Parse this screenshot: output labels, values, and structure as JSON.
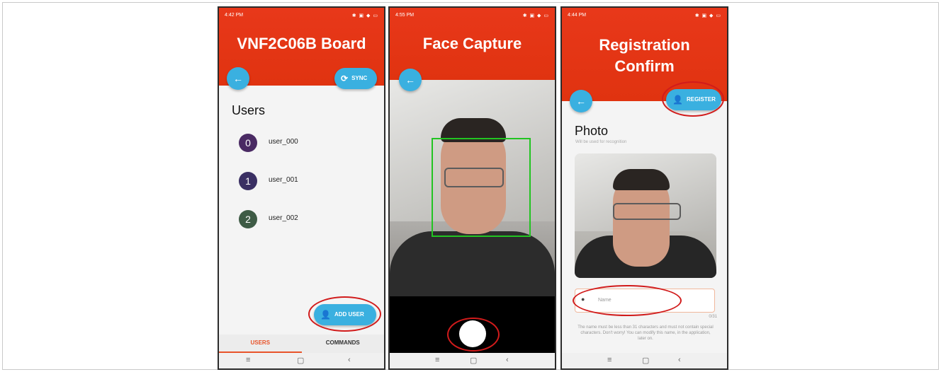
{
  "screens": {
    "board": {
      "status_time": "4:42 PM",
      "status_icons": "✱ ▣ ◆ ▭",
      "title": "VNF2C06B Board",
      "back_icon": "←",
      "sync_label": "SYNC",
      "users_heading": "Users",
      "users": [
        {
          "index": "0",
          "name": "user_000",
          "color": "#4a2a63"
        },
        {
          "index": "1",
          "name": "user_001",
          "color": "#3a2f63"
        },
        {
          "index": "2",
          "name": "user_002",
          "color": "#3e5b45"
        }
      ],
      "add_user_label": "ADD USER",
      "tabs": [
        "USERS",
        "COMMANDS"
      ]
    },
    "capture": {
      "status_time": "4:55 PM",
      "status_icons": "✱ ▣ ◆ ▭",
      "title": "Face Capture",
      "back_icon": "←"
    },
    "register": {
      "status_time": "4:44 PM",
      "status_icons": "✱ ▣ ◆ ▭",
      "title_line1": "Registration",
      "title_line2": "Confirm",
      "back_icon": "←",
      "register_label": "REGISTER",
      "photo_heading": "Photo",
      "photo_hint": "Will be used for recognition",
      "name_placeholder": "Name",
      "name_counter": "0/31",
      "name_notice": "The name must be less than 31 characters and must not contain special characters. Don't worry! You can modify this name, in the application, later on."
    }
  },
  "nav_buttons": {
    "menu": "≡",
    "home": "▢",
    "back": "‹"
  },
  "colors": {
    "header": "#e63a18",
    "accent": "#3ab0e0",
    "highlight_ring": "#d11b1b",
    "face_box": "#22c422"
  }
}
